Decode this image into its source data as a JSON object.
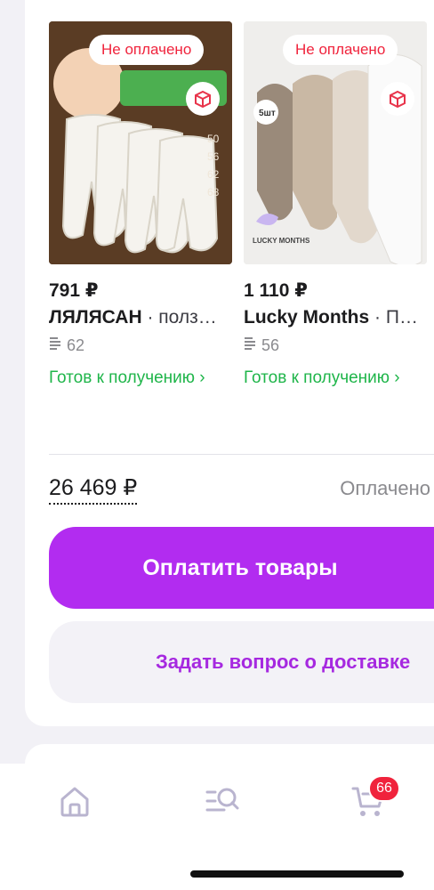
{
  "products": [
    {
      "badge": "Не оплачено",
      "price": "791 ₽",
      "brand": "ЛЯЛЯСАН",
      "category": " · полз…",
      "reviews": "62",
      "availability": "Готов к получению ›"
    },
    {
      "badge": "Не оплачено",
      "price": "1 110 ₽",
      "brand": "Lucky Months",
      "category": " · П…",
      "reviews": "56",
      "availability": "Готов к получению ›"
    }
  ],
  "order": {
    "total": "26 469 ₽",
    "status": "Оплачено"
  },
  "actions": {
    "pay_label": "Оплатить товары",
    "ask_label": "Задать вопрос о доставке"
  },
  "tabbar": {
    "cart_count": "66",
    "icons": [
      "home-icon",
      "catalog-search-icon",
      "cart-icon"
    ]
  },
  "colors": {
    "accent": "#b22cf0",
    "accent_text": "#a629e0",
    "alert": "#f0233c",
    "success": "#1fb54a"
  }
}
